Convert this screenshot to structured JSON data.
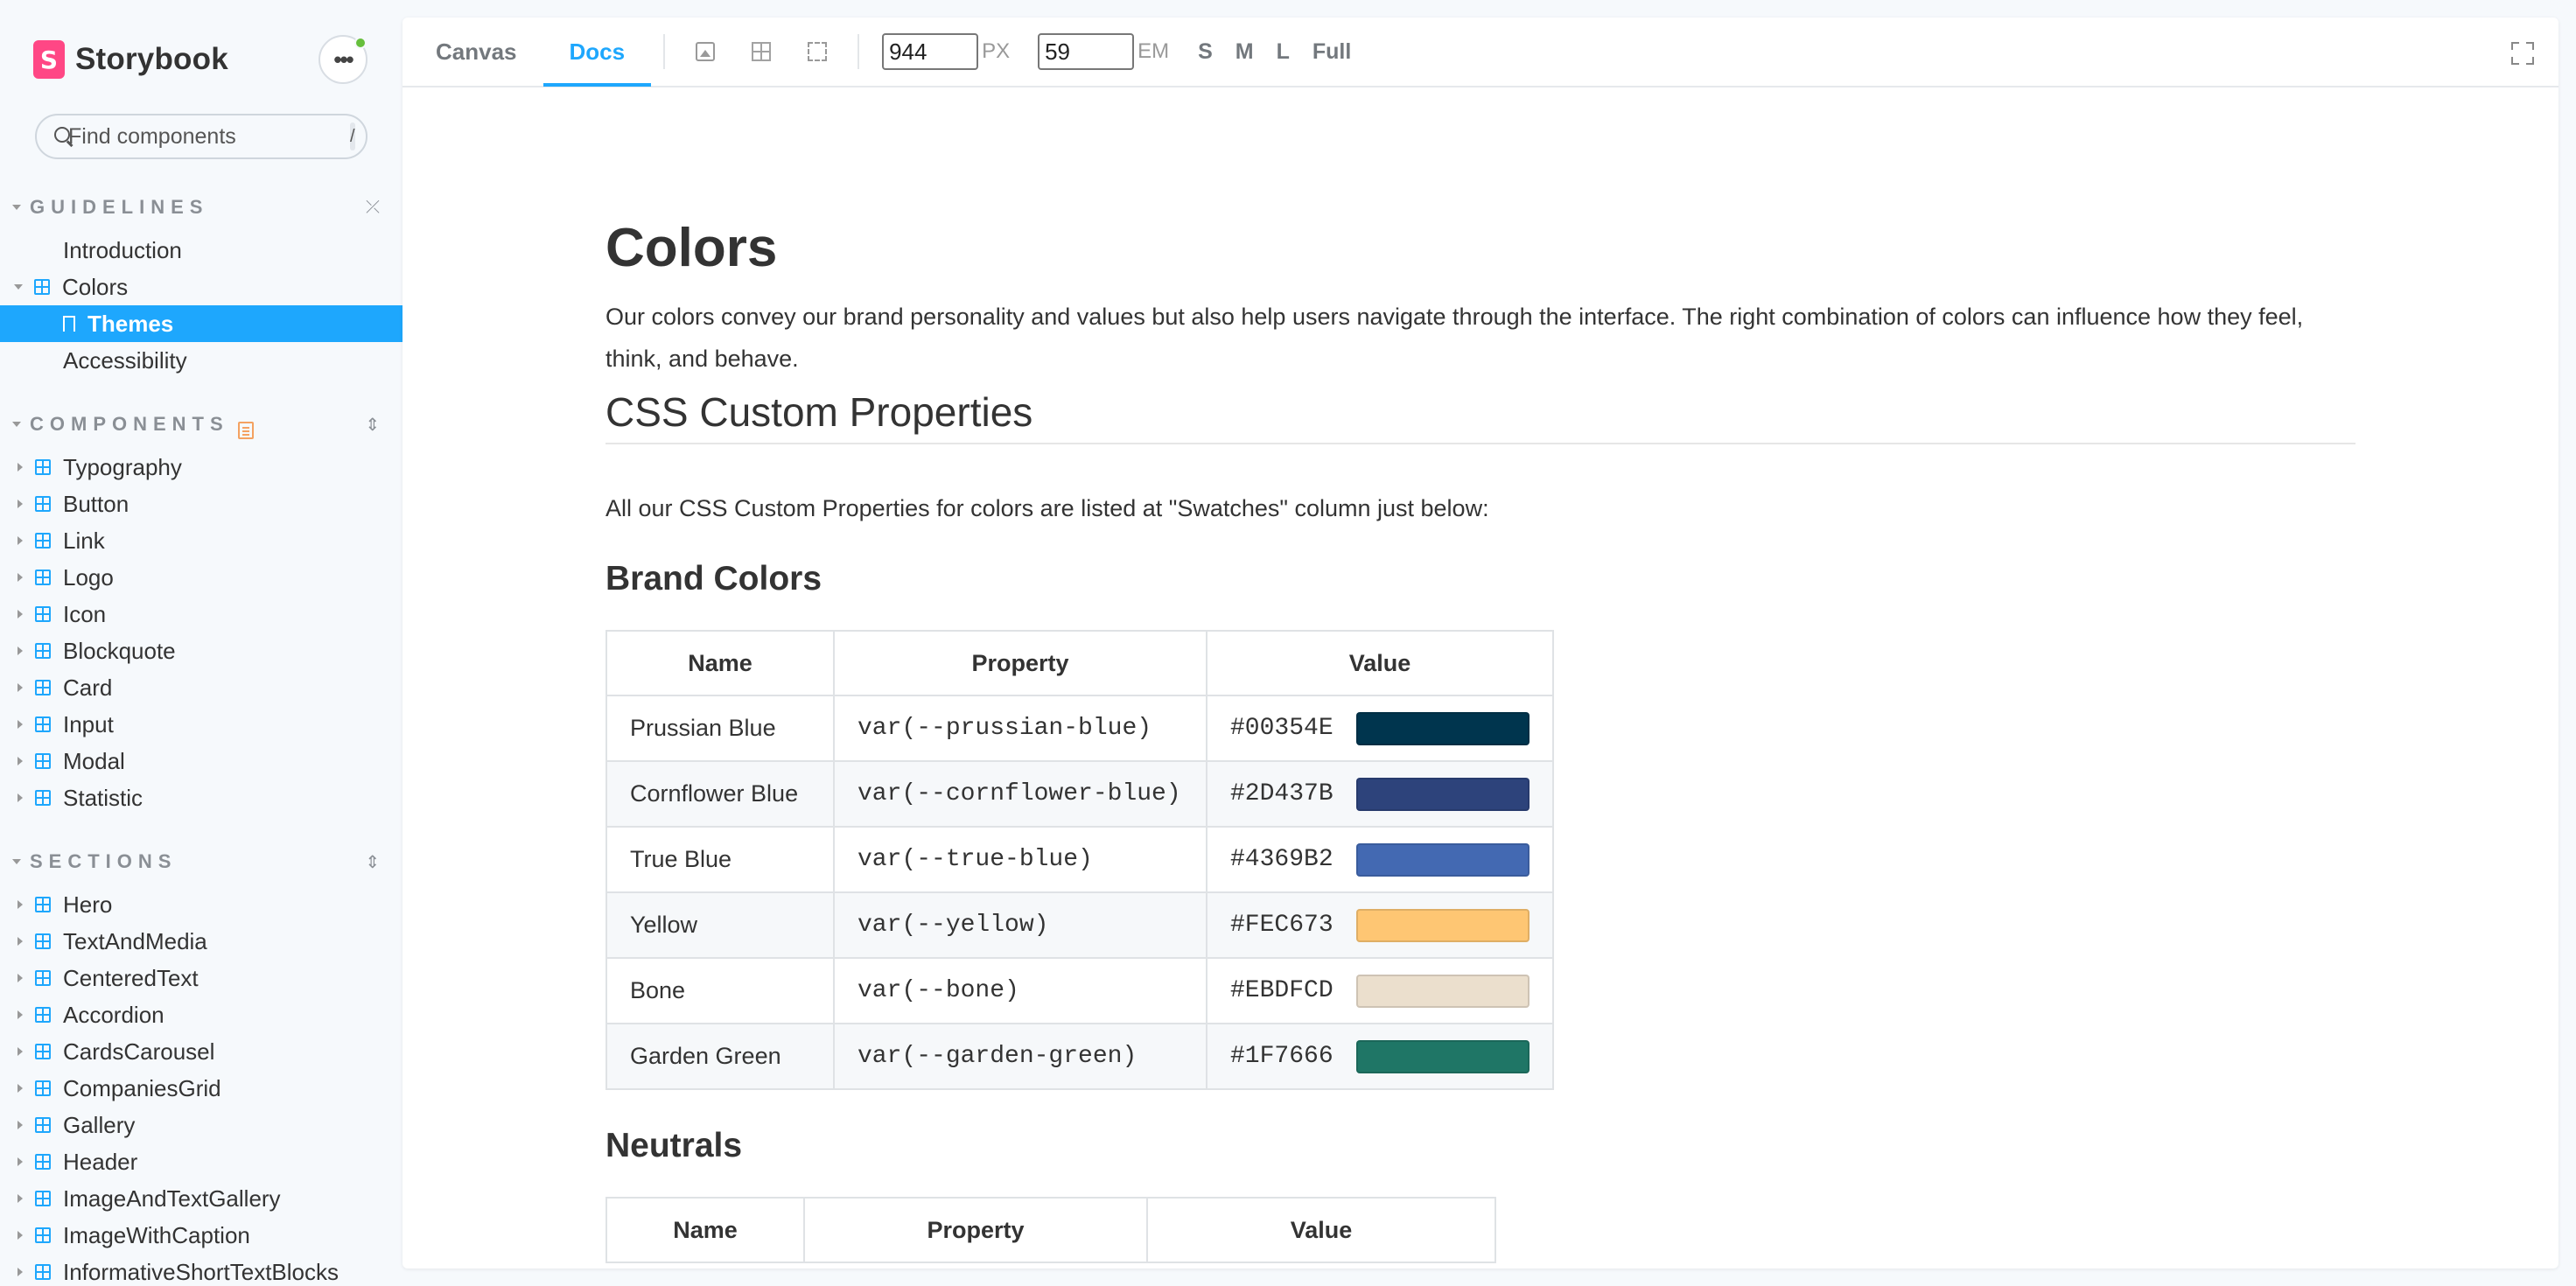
{
  "brand": {
    "logo_letter": "S",
    "name": "Storybook"
  },
  "search": {
    "placeholder": "Find components",
    "shortcut": "/"
  },
  "sidebar": {
    "guidelines": {
      "title": "GUIDELINES",
      "items": [
        {
          "label": "Introduction",
          "type": "doc"
        },
        {
          "label": "Colors",
          "type": "component",
          "expanded": true
        },
        {
          "label": "Themes",
          "type": "story",
          "selected": true
        },
        {
          "label": "Accessibility",
          "type": "doc"
        }
      ]
    },
    "components": {
      "title": "COMPONENTS",
      "items": [
        "Typography",
        "Button",
        "Link",
        "Logo",
        "Icon",
        "Blockquote",
        "Card",
        "Input",
        "Modal",
        "Statistic"
      ]
    },
    "sections": {
      "title": "SECTIONS",
      "items": [
        "Hero",
        "TextAndMedia",
        "CenteredText",
        "Accordion",
        "CardsCarousel",
        "CompaniesGrid",
        "Gallery",
        "Header",
        "ImageAndTextGallery",
        "ImageWithCaption",
        "InformativeShortTextBlocks"
      ]
    }
  },
  "toolbar": {
    "tabs": [
      "Canvas",
      "Docs"
    ],
    "active_tab": "Docs",
    "width_value": "944",
    "width_unit": "PX",
    "height_value": "59",
    "height_unit": "EM",
    "sizes": [
      "S",
      "M",
      "L",
      "Full"
    ]
  },
  "doc": {
    "title": "Colors",
    "intro": "Our colors convey our brand personality and values but also help users navigate through the interface. The right combination of colors can influence how they feel, think, and behave.",
    "section_title": "CSS Custom Properties",
    "lead": "All our CSS Custom Properties for colors are listed at \"Swatches\" column just below:",
    "brand_title": "Brand Colors",
    "table_headers": [
      "Name",
      "Property",
      "Value"
    ],
    "brand_colors": [
      {
        "name": "Prussian Blue",
        "property": "var(--prussian-blue)",
        "value": "#00354E"
      },
      {
        "name": "Cornflower Blue",
        "property": "var(--cornflower-blue)",
        "value": "#2D437B"
      },
      {
        "name": "True Blue",
        "property": "var(--true-blue)",
        "value": "#4369B2"
      },
      {
        "name": "Yellow",
        "property": "var(--yellow)",
        "value": "#FEC673"
      },
      {
        "name": "Bone",
        "property": "var(--bone)",
        "value": "#EBDFCD"
      },
      {
        "name": "Garden Green",
        "property": "var(--garden-green)",
        "value": "#1F7666"
      }
    ],
    "neutrals_title": "Neutrals"
  }
}
